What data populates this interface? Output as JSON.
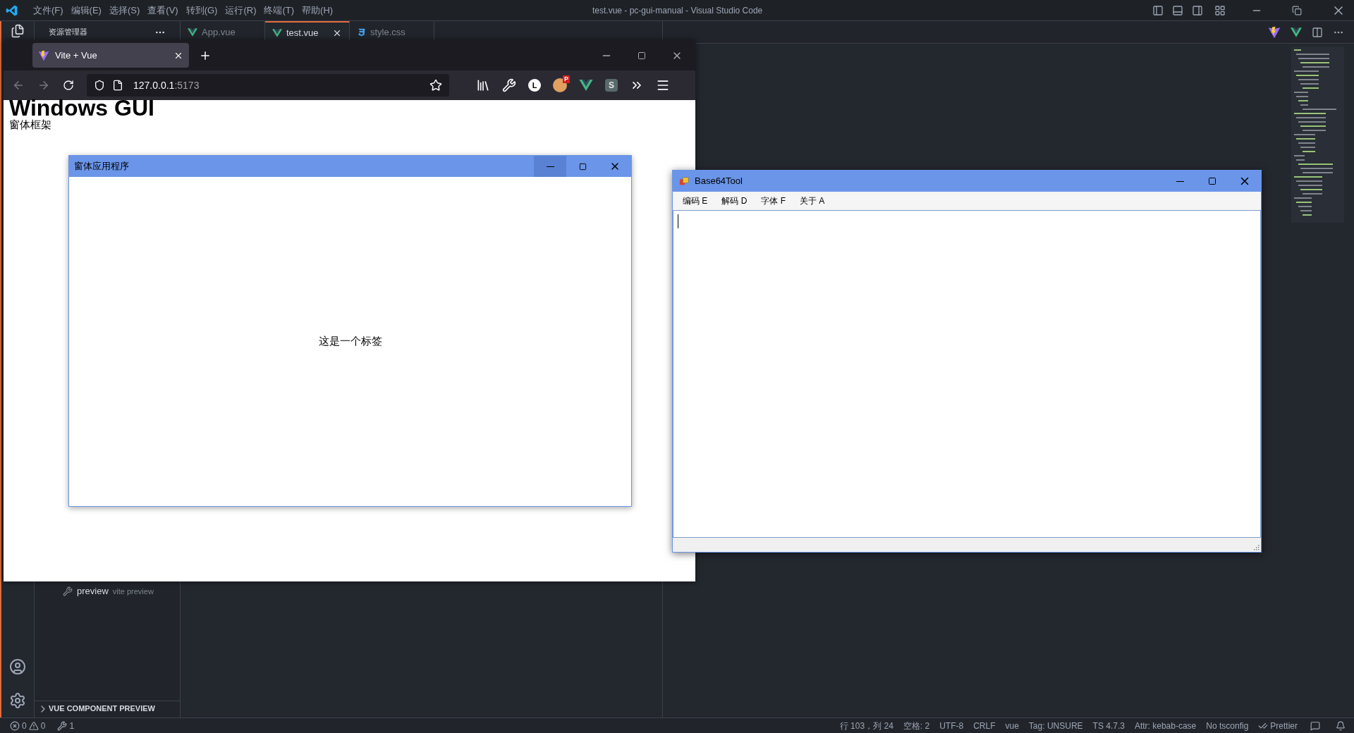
{
  "vscode": {
    "title": "test.vue - pc-gui-manual - Visual Studio Code",
    "menu": [
      "文件(F)",
      "编辑(E)",
      "选择(S)",
      "查看(V)",
      "转到(G)",
      "运行(R)",
      "终端(T)",
      "帮助(H)"
    ],
    "sidebar_title": "资源管理器",
    "tabs": [
      {
        "label": "App.vue",
        "kind": "vue",
        "selected": false
      },
      {
        "label": "test.vue",
        "kind": "vue",
        "selected": true
      },
      {
        "label": "style.css",
        "kind": "css",
        "selected": false
      }
    ],
    "scripts": [
      {
        "name": "preview",
        "command": "vite preview"
      }
    ],
    "panel_section": "VUE COMPONENT PREVIEW",
    "status_left": {
      "errors": "0",
      "warnings": "0",
      "tools": "1"
    },
    "status_right": [
      "行 103，列 24",
      "空格: 2",
      "UTF-8",
      "CRLF",
      "vue",
      "Tag: UNSURE",
      "TS 4.7.3",
      "Attr: kebab-case",
      "No tsconfig",
      "Prettier"
    ]
  },
  "browser": {
    "tab": "Vite + Vue",
    "url_host": "127.0.0.1",
    "url_port": ":5173",
    "extensions": [
      {
        "kind": "library"
      },
      {
        "kind": "wrench"
      },
      {
        "kind": "letter",
        "text": "L"
      },
      {
        "kind": "badge",
        "text": "P"
      },
      {
        "kind": "vue"
      },
      {
        "kind": "square",
        "text": "S"
      },
      {
        "kind": "more"
      },
      {
        "kind": "menu"
      }
    ],
    "page": {
      "heading": "Windows GUI",
      "subheading": "窗体框架",
      "window": {
        "title": "窗体应用程序",
        "label": "这是一个标签"
      }
    }
  },
  "base64_tool": {
    "title": "Base64Tool",
    "menu": [
      "编码 E",
      "解码 D",
      "字体 F",
      "关于 A"
    ]
  }
}
